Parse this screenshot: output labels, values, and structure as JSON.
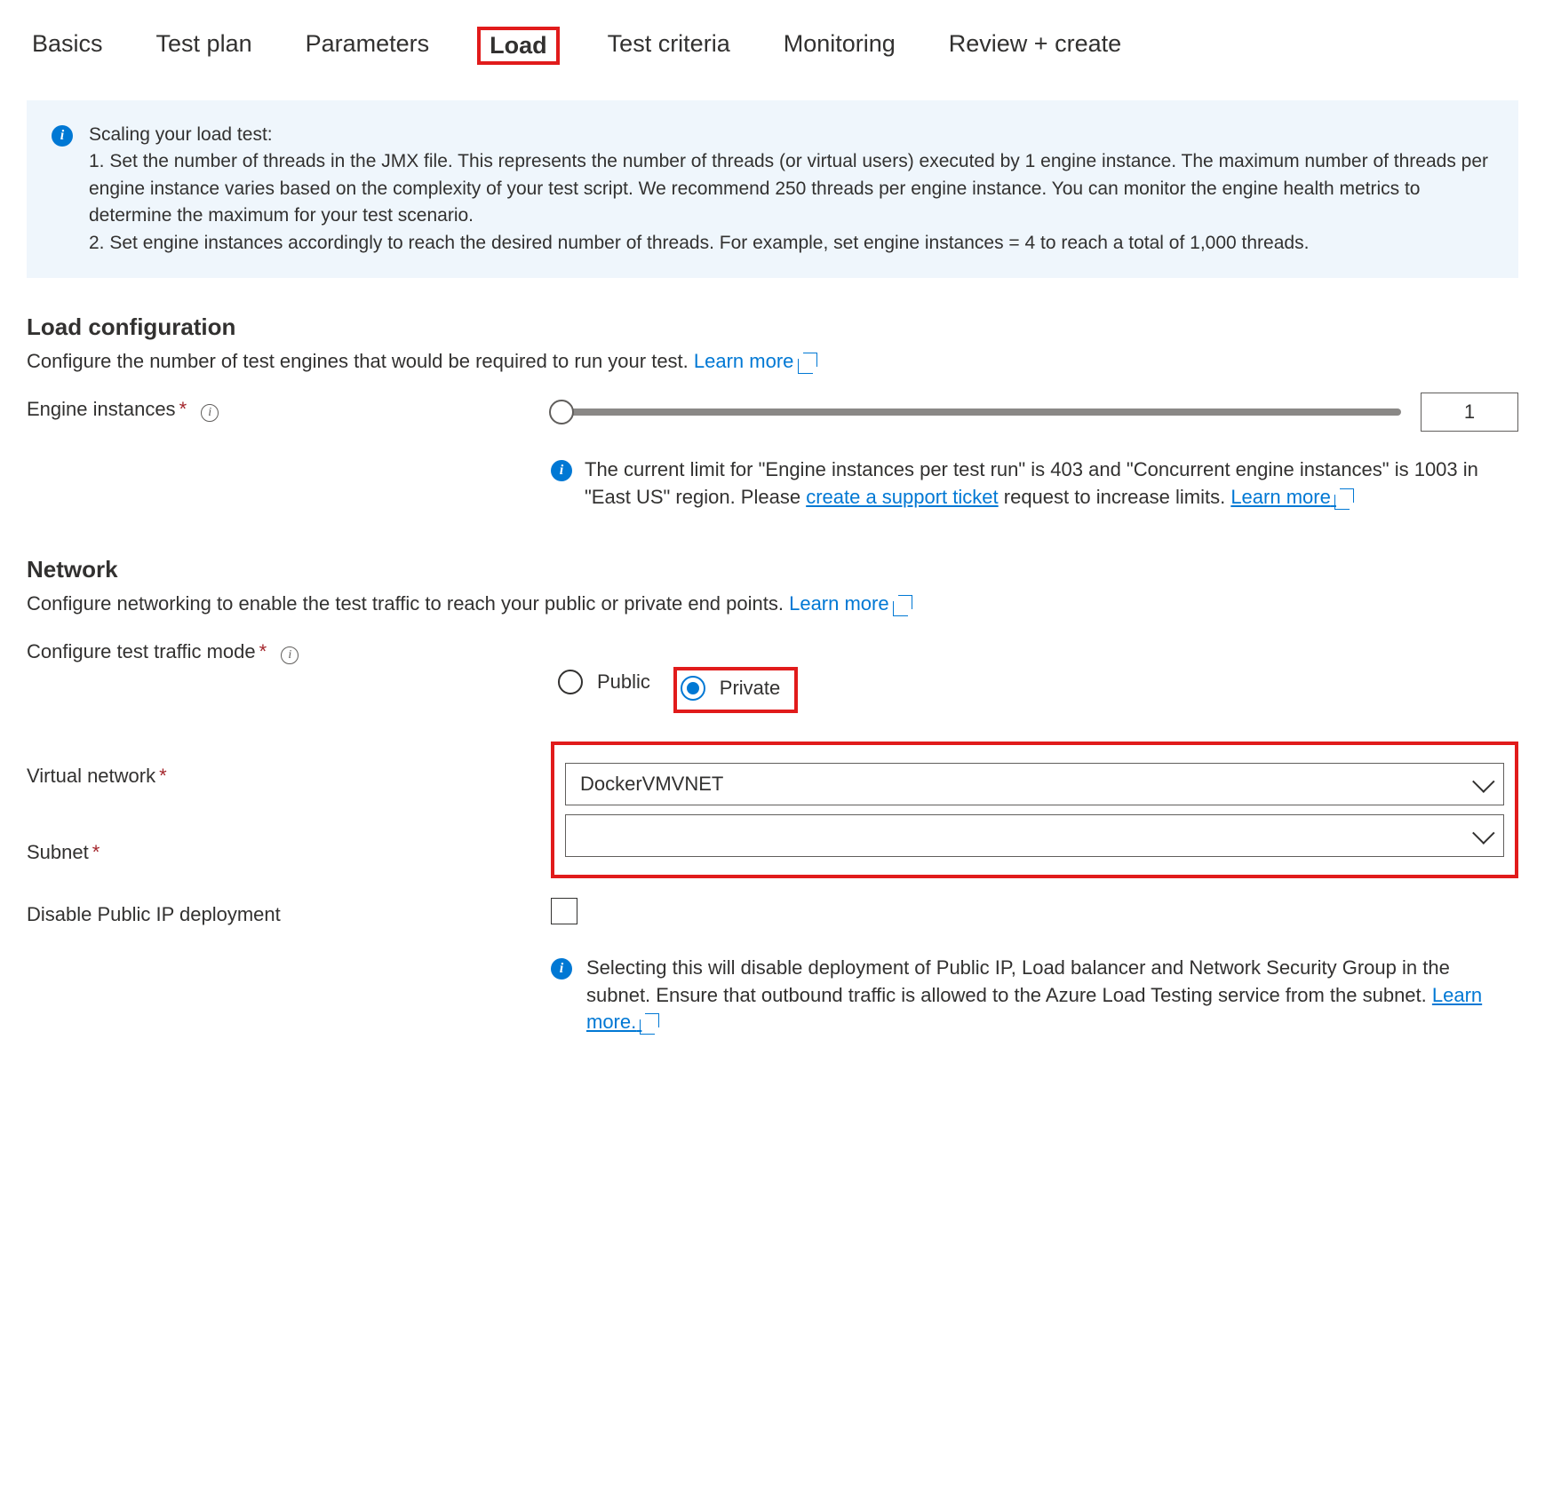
{
  "tabs": {
    "basics": "Basics",
    "test_plan": "Test plan",
    "parameters": "Parameters",
    "load": "Load",
    "test_criteria": "Test criteria",
    "monitoring": "Monitoring",
    "review_create": "Review + create"
  },
  "scaling_info": "Scaling your load test:\n1. Set the number of threads in the JMX file. This represents the number of threads (or virtual users) executed by 1 engine instance. The maximum number of threads per engine instance varies based on the complexity of your test script. We recommend 250 threads per engine instance. You can monitor the engine health metrics to determine the maximum for your test scenario.\n2. Set engine instances accordingly to reach the desired number of threads. For example, set engine instances = 4 to reach a total of 1,000 threads.",
  "load_cfg": {
    "title": "Load configuration",
    "desc": "Configure the number of test engines that would be required to run your test. ",
    "learn_more": "Learn more",
    "engine_instances_label": "Engine instances",
    "engine_instances_value": "1",
    "limits_text_1": "The current limit for \"Engine instances per test run\" is 403 and \"Concurrent engine instances\" is 1003 in \"East US\" region. Please ",
    "limits_link": "create a support ticket",
    "limits_text_2": " request to increase limits. ",
    "limits_learn_more": "Learn more"
  },
  "network": {
    "title": "Network",
    "desc": "Configure networking to enable the test traffic to reach your public or private end points. ",
    "learn_more": "Learn more",
    "traffic_mode_label": "Configure test traffic mode",
    "radio_public": "Public",
    "radio_private": "Private",
    "vnet_label": "Virtual network",
    "vnet_value": "DockerVMVNET",
    "subnet_label": "Subnet",
    "subnet_value": "",
    "disable_public_ip_label": "Disable Public IP deployment",
    "disable_public_ip_note": "Selecting this will disable deployment of Public IP, Load balancer and Network Security Group in the subnet. Ensure that outbound traffic is allowed to the Azure Load Testing service from the subnet. ",
    "disable_public_ip_learn_more": "Learn more."
  }
}
